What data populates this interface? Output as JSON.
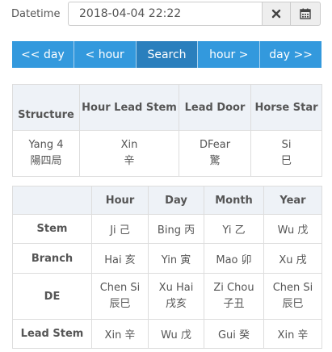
{
  "datetime": {
    "label": "Datetime",
    "value": "2018-04-04 22:22",
    "clear_icon": "x-icon",
    "calendar_icon": "calendar-icon"
  },
  "nav": {
    "buttons": [
      "<< day",
      "< hour",
      "Search",
      "hour >",
      "day >>"
    ],
    "active_index": 2
  },
  "structure_table": {
    "headers": [
      "Structure",
      "Hour Lead Stem",
      "Lead Door",
      "Horse Star"
    ],
    "row": [
      [
        "Yang 4",
        "陽四局"
      ],
      [
        "Xin",
        "辛"
      ],
      [
        "DFear",
        "驚"
      ],
      [
        "Si",
        "巳"
      ]
    ]
  },
  "pillars_table": {
    "headers": [
      "",
      "Hour",
      "Day",
      "Month",
      "Year"
    ],
    "rows": [
      {
        "label": "Stem",
        "cells": [
          [
            "Ji 己"
          ],
          [
            "Bing 丙"
          ],
          [
            "Yi 乙"
          ],
          [
            "Wu 戊"
          ]
        ]
      },
      {
        "label": "Branch",
        "cells": [
          [
            "Hai 亥"
          ],
          [
            "Yin 寅"
          ],
          [
            "Mao 卯"
          ],
          [
            "Xu 戌"
          ]
        ]
      },
      {
        "label": "DE",
        "cells": [
          [
            "Chen Si",
            "辰巳"
          ],
          [
            "Xu Hai",
            "戌亥"
          ],
          [
            "Zi Chou",
            "子丑"
          ],
          [
            "Chen Si",
            "辰巳"
          ]
        ]
      },
      {
        "label": "Lead Stem",
        "cells": [
          [
            "Xin 辛"
          ],
          [
            "Wu 戊"
          ],
          [
            "Gui 癸"
          ],
          [
            "Xin 辛"
          ]
        ]
      }
    ]
  }
}
